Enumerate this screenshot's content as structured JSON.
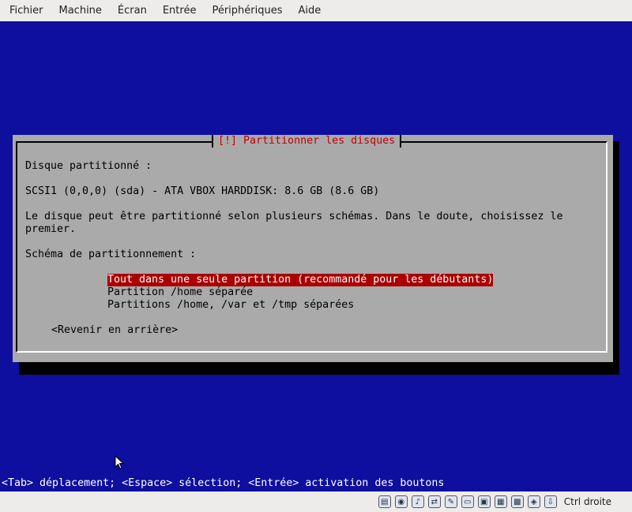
{
  "menubar": {
    "items": [
      "Fichier",
      "Machine",
      "Écran",
      "Entrée",
      "Périphériques",
      "Aide"
    ]
  },
  "dialog": {
    "title": "[!] Partitionner les disques",
    "disk_label": "Disque partitionné :",
    "disk_value": "SCSI1 (0,0,0) (sda) - ATA VBOX HARDDISK: 8.6 GB (8.6 GB)",
    "description_line1": "Le disque peut être partitionné selon plusieurs schémas. Dans le doute, choisissez le",
    "description_line2": "premier.",
    "scheme_label": "Schéma de partitionnement :",
    "options": [
      "Tout dans une seule partition (recommandé pour les débutants)",
      "Partition /home séparée",
      "Partitions /home, /var et /tmp séparées"
    ],
    "selected_index": 0,
    "back_button": "<Revenir en arrière>"
  },
  "helpbar": {
    "text": "<Tab> déplacement; <Espace> sélection; <Entrée> activation des boutons"
  },
  "statusbar": {
    "icons": [
      "hard-disk-icon",
      "optical-drive-icon",
      "audio-icon",
      "network-icon",
      "usb-icon",
      "shared-folder-icon",
      "display-icon",
      "video-capture-icon",
      "cpu-icon",
      "mouse-integration-icon",
      "download-icon"
    ],
    "host_key": "Ctrl droite"
  },
  "colors": {
    "console_bg": "#0e0f9f",
    "dialog_bg": "#aaaaaa",
    "title_text": "#c00000",
    "selection_bg": "#aa0000"
  }
}
